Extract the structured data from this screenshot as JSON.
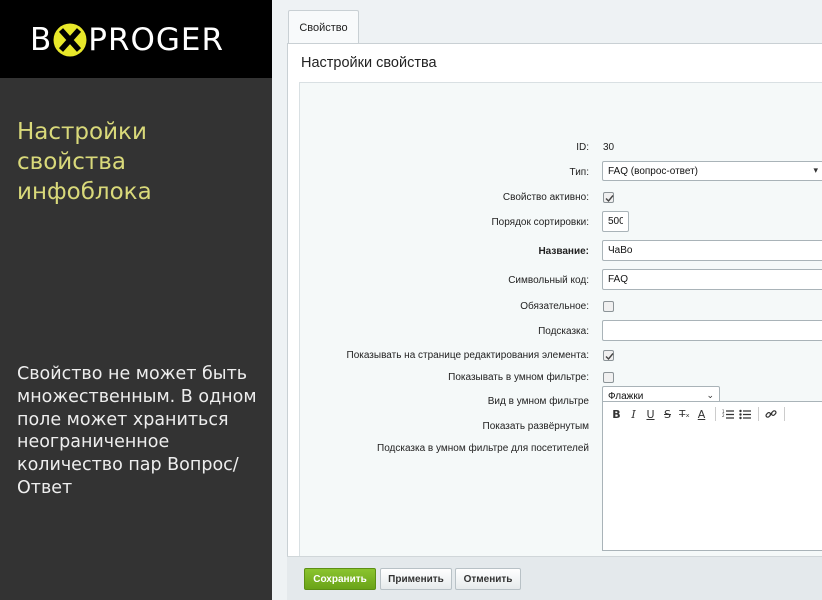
{
  "brand": {
    "logo_left": "B",
    "logo_right": "PROGER",
    "logo_x_color": "#e8e82a"
  },
  "left_panel": {
    "title": "Настройки свойства инфоблока",
    "description": "Свойство не может быть множественным. В одном поле может храниться неограниченное количество пар Вопрос/Ответ"
  },
  "tabs": [
    {
      "label": "Свойство",
      "active": true
    }
  ],
  "section_title": "Настройки свойства",
  "form": {
    "id_label": "ID:",
    "id_value": "30",
    "type_label": "Тип:",
    "type_value": "FAQ (вопрос-ответ)",
    "active_label": "Свойство активно:",
    "active_checked": true,
    "sort_label": "Порядок сортировки:",
    "sort_value": "500",
    "name_label": "Название:",
    "name_value": "ЧаВо",
    "code_label": "Символьный код:",
    "code_value": "FAQ",
    "required_label": "Обязательное:",
    "required_checked": false,
    "hint_label": "Подсказка:",
    "hint_value": "",
    "show_edit_label": "Показывать на странице редактирования элемента:",
    "show_edit_checked": true,
    "smart_filter_label": "Показывать в умном фильтре:",
    "smart_filter_checked": false,
    "filter_view_label": "Вид в умном фильтре",
    "filter_view_value": "Флажки",
    "expanded_label": "Показать развёрнутым",
    "expanded_checked": false,
    "filter_hint_label": "Подсказка в умном фильтре для посетителей"
  },
  "editor_toolbar": [
    "bold-icon",
    "italic-icon",
    "underline-icon",
    "strikethrough-icon",
    "clear-format-icon",
    "font-color-icon",
    "ordered-list-icon",
    "unordered-list-icon",
    "link-icon"
  ],
  "buttons": {
    "save": "Сохранить",
    "apply": "Применить",
    "cancel": "Отменить"
  },
  "colors": {
    "accent_green": "#7ab526",
    "left_bg": "#333333",
    "title_yellow": "#d9d97a"
  }
}
